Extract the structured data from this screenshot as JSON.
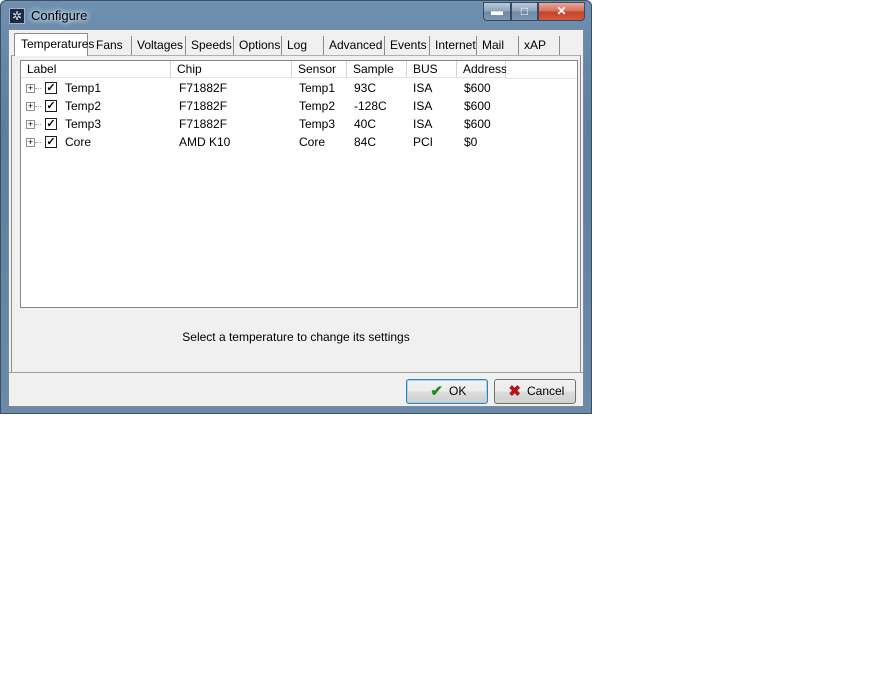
{
  "window": {
    "title": "Configure",
    "app_icon": "fan-icon",
    "controls": {
      "minimize": "▬",
      "maximize": "□",
      "close": "✕"
    }
  },
  "tabs": [
    {
      "label": "Temperatures",
      "active": true
    },
    {
      "label": "Fans"
    },
    {
      "label": "Voltages"
    },
    {
      "label": "Speeds"
    },
    {
      "label": "Options"
    },
    {
      "label": "Log"
    },
    {
      "label": "Advanced"
    },
    {
      "label": "Events"
    },
    {
      "label": "Internet"
    },
    {
      "label": "Mail"
    },
    {
      "label": "xAP"
    }
  ],
  "table": {
    "columns": [
      "Label",
      "Chip",
      "Sensor",
      "Sample",
      "BUS",
      "Address"
    ],
    "rows": [
      {
        "label": "Temp1",
        "chip": "F71882F",
        "sensor": "Temp1",
        "sample": "93C",
        "bus": "ISA",
        "address": "$600",
        "checked": true
      },
      {
        "label": "Temp2",
        "chip": "F71882F",
        "sensor": "Temp2",
        "sample": "-128C",
        "bus": "ISA",
        "address": "$600",
        "checked": true
      },
      {
        "label": "Temp3",
        "chip": "F71882F",
        "sensor": "Temp3",
        "sample": "40C",
        "bus": "ISA",
        "address": "$600",
        "checked": true
      },
      {
        "label": "Core",
        "chip": "AMD K10",
        "sensor": "Core",
        "sample": "84C",
        "bus": "PCI",
        "address": "$0",
        "checked": true
      }
    ]
  },
  "status": "Select a temperature to change its settings",
  "buttons": {
    "ok": "OK",
    "cancel": "Cancel"
  },
  "glyphs": {
    "expander": "+",
    "check": "✓",
    "ok_icon": "✔",
    "cancel_icon": "✖"
  }
}
